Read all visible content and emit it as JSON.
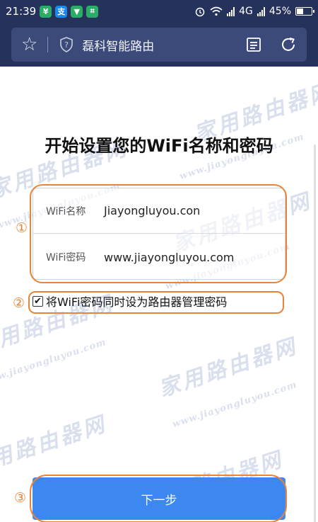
{
  "status_bar": {
    "time": "21:39",
    "app_icons": [
      {
        "name": "wechat-pay-icon",
        "color": "#2aae67",
        "glyph": "¥"
      },
      {
        "name": "alipay-icon",
        "color": "#1e88e5",
        "glyph": "支"
      },
      {
        "name": "vpn-icon",
        "color": "#2aae67",
        "glyph": "▼"
      },
      {
        "name": "scanner-icon",
        "color": "#2aae67",
        "glyph": "⌗"
      }
    ],
    "network": "4G",
    "battery_percent_label": "45%",
    "battery_level": 0.45
  },
  "browser": {
    "title": "磊科智能路由",
    "bookmark_icon": "star-icon",
    "site_icon": "shield-question-icon",
    "reader_icon": "reader-icon",
    "refresh_icon": "refresh-icon"
  },
  "page": {
    "heading": "开始设置您的WiFi名称和密码",
    "wifi_name_label": "WiFi名称",
    "wifi_name_value": "Jiayongluyou.con",
    "wifi_password_label": "WiFi密码",
    "wifi_password_value": "www.jiayongluyou.com",
    "sync_password_label": "将WiFi密码同时设为路由器管理密码",
    "sync_password_checked": true,
    "next_button_label": "下一步"
  },
  "annotations": {
    "marker_1": "①",
    "marker_2": "②",
    "marker_3": "③",
    "highlight_color": "#e6853a"
  },
  "watermark": {
    "cn_text": "家用路由器网",
    "en_text": "www.jiayongluyou.com"
  }
}
